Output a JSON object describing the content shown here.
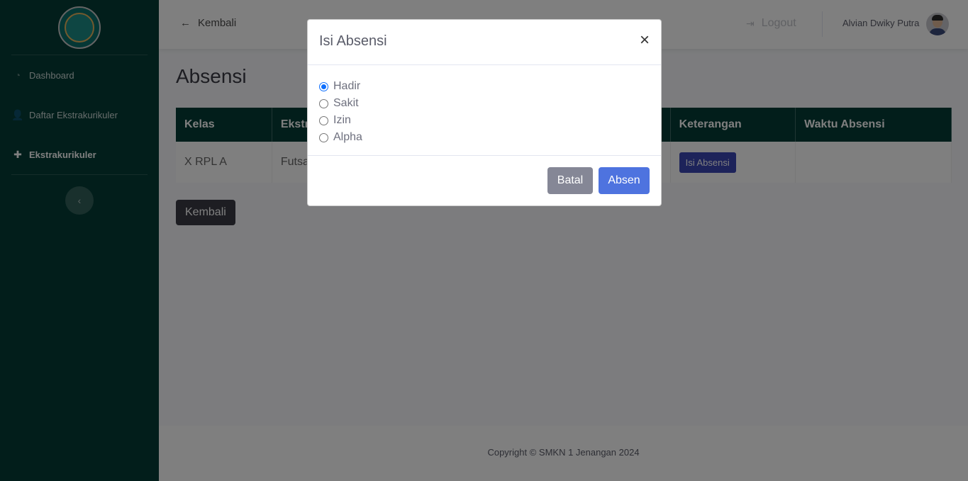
{
  "sidebar": {
    "items": [
      {
        "label": "Dashboard",
        "icon": "tachometer-icon"
      },
      {
        "label": "Daftar Ekstrakurikuler",
        "icon": "user-edit-icon"
      },
      {
        "label": "Ekstrakurikuler",
        "icon": "puzzle-icon",
        "active": true
      }
    ],
    "toggle_icon": "chevron-left-icon"
  },
  "topbar": {
    "back_label": "Kembali",
    "logout_label": "Logout",
    "user_name": "Alvian Dwiky Putra"
  },
  "main": {
    "title": "Absensi",
    "table": {
      "headers": [
        "Kelas",
        "Ekstra",
        "",
        "",
        "",
        "Keterangan",
        "Waktu Absensi"
      ],
      "rows": [
        {
          "kelas": "X RPL A",
          "ekstra": "Futsa",
          "action": "Isi Absensi",
          "waktu": ""
        }
      ]
    },
    "back_button": "Kembali"
  },
  "footer": {
    "copyright": "Copyright © SMKN 1 Jenangan 2024"
  },
  "modal": {
    "title": "Isi Absensi",
    "close": "×",
    "options": [
      {
        "label": "Hadir",
        "checked": true
      },
      {
        "label": "Sakit",
        "checked": false
      },
      {
        "label": "Izin",
        "checked": false
      },
      {
        "label": "Alpha",
        "checked": false
      }
    ],
    "cancel_label": "Batal",
    "submit_label": "Absen"
  },
  "colors": {
    "sidebar_bg": "#053d36",
    "primary": "#4e73df",
    "secondary": "#858796",
    "dark": "#3a3b45"
  }
}
